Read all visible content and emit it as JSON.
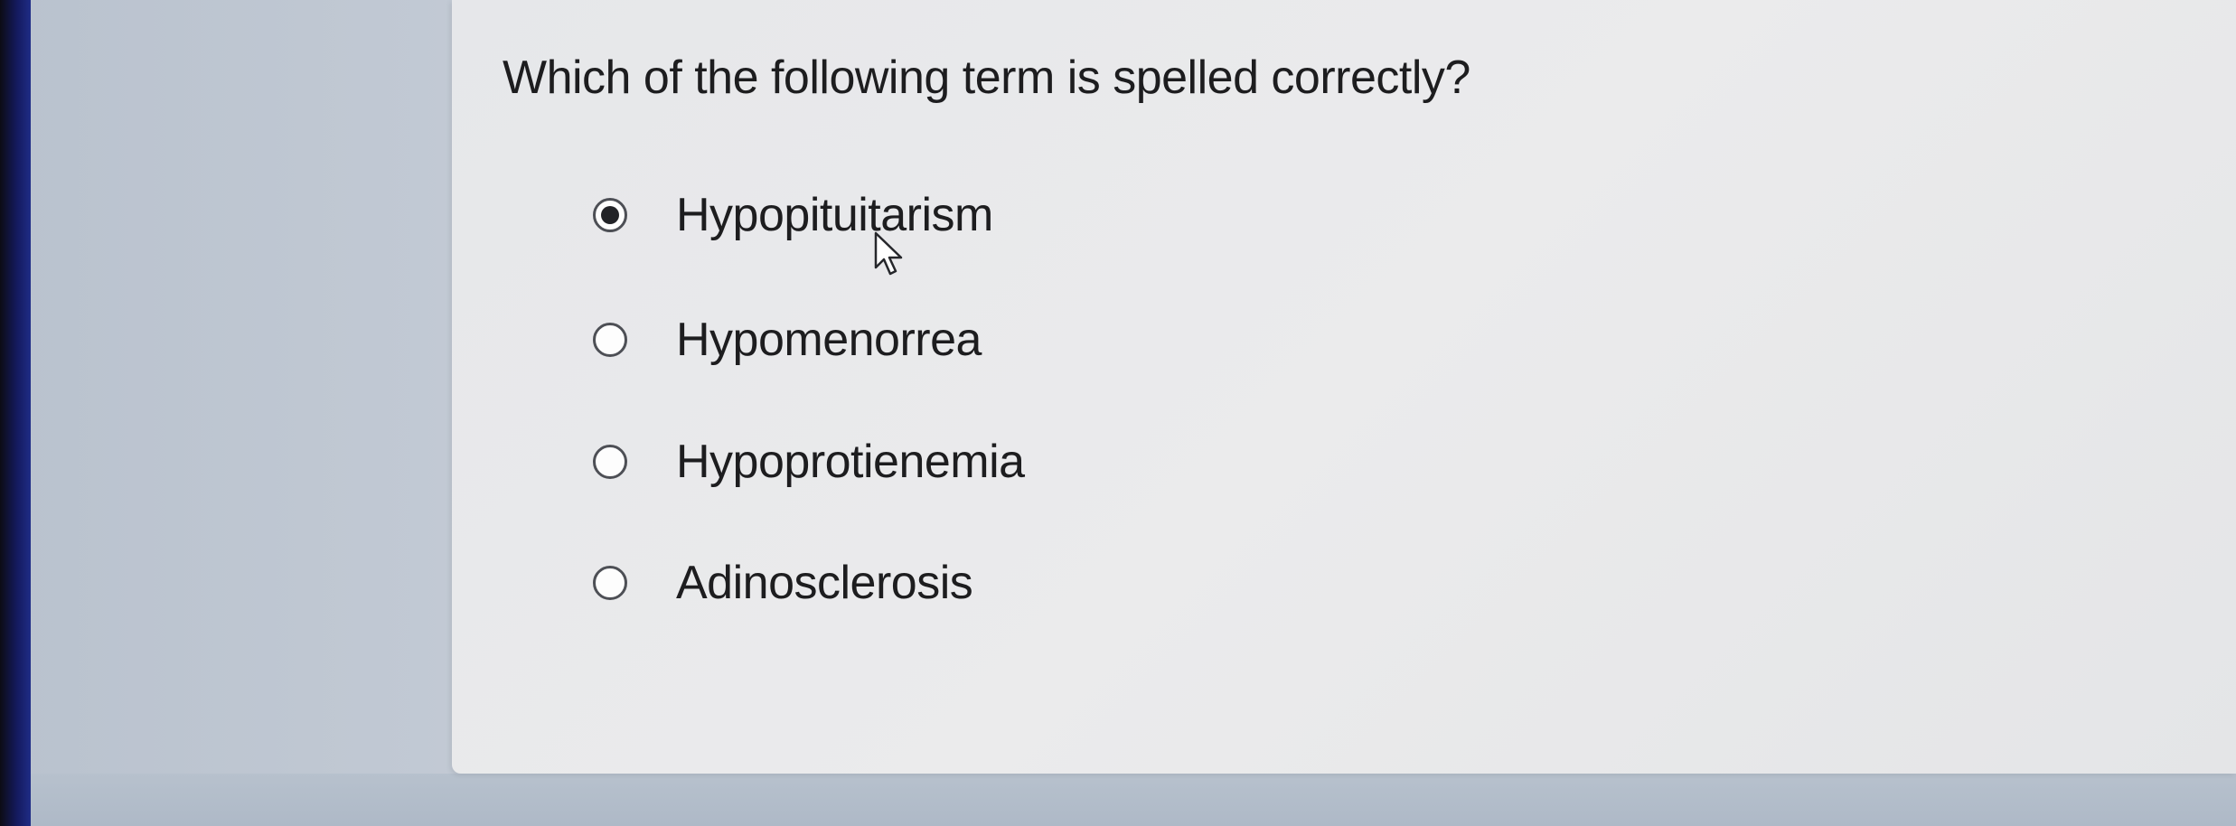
{
  "question": {
    "text": "Which of the following term is spelled correctly?"
  },
  "options": [
    {
      "label": "Hypopituitarism",
      "selected": true
    },
    {
      "label": "Hypomenorrea",
      "selected": false
    },
    {
      "label": "Hypoprotienemia",
      "selected": false
    },
    {
      "label": "Adinosclerosis",
      "selected": false
    }
  ],
  "icons": {
    "cursor": "mouse-pointer-icon"
  }
}
